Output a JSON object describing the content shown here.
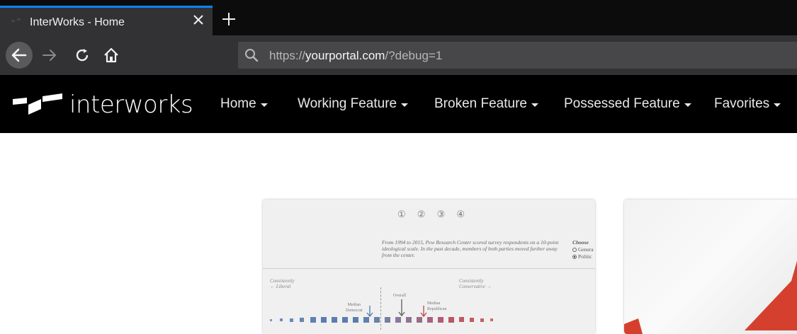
{
  "browser": {
    "tab_title": "InterWorks - Home",
    "url_prefix": "https://",
    "url_domain": "yourportal.com",
    "url_suffix": "/?debug=1",
    "accent_color": "#0a84ff"
  },
  "site": {
    "logo_text": "interworks",
    "menu": [
      {
        "label": "Home"
      },
      {
        "label": "Working Feature"
      },
      {
        "label": "Broken Feature"
      },
      {
        "label": "Possessed Feature"
      },
      {
        "label": "Favorites"
      }
    ]
  },
  "card1": {
    "steps": "① ② ③ ④",
    "blurb": "From 1994 to 2015, Pew Research Center scored survey respondents on a 10-point ideological scale. In the past decade, members of both parties moved further away from the center.",
    "choose_label": "Choose",
    "choose_option_1": "Genera",
    "choose_option_2": "Politic",
    "left_label_1": "Consistently",
    "left_label_2": "← Liberal",
    "right_label_1": "Consistently",
    "right_label_2": "Conservative →",
    "overall_label": "Overall",
    "median_dem_1": "Median",
    "median_dem_2": "Democrat",
    "median_rep_1": "Median",
    "median_rep_2": "Republican",
    "colors": {
      "liberal": "#5a7fb0",
      "conservative": "#c0504d"
    }
  }
}
